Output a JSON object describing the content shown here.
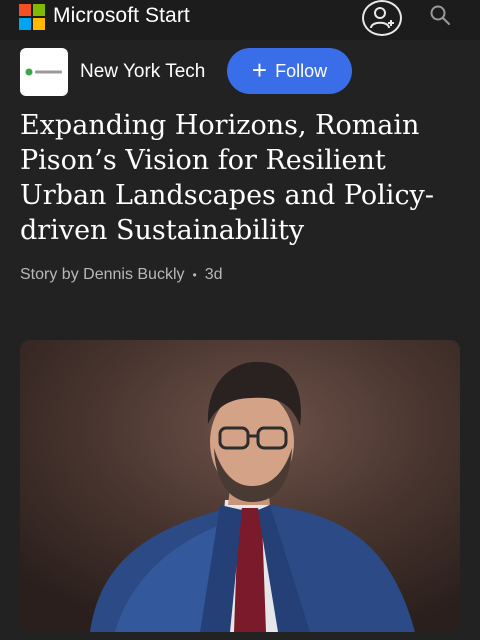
{
  "app": {
    "brand_name": "Microsoft Start",
    "logo_colors": [
      "#f25022",
      "#7fba00",
      "#00a4ef",
      "#ffb900"
    ]
  },
  "header": {
    "profile_icon": "person-add-icon",
    "search_icon": "search-icon"
  },
  "source": {
    "name": "New York Tech",
    "logo_text": "NEW YORK TECH",
    "follow_label": "Follow"
  },
  "article": {
    "headline": "Expanding Horizons, Romain Pison’s Vision for Resilient Urban Landscapes and Policy-driven Sustainability",
    "byline": "Story by Dennis Buckly",
    "age": "3d"
  },
  "colors": {
    "background": "#222222",
    "topbar": "#1c1c1c",
    "accent": "#3a6ee8",
    "muted_text": "#b8b8b8"
  }
}
